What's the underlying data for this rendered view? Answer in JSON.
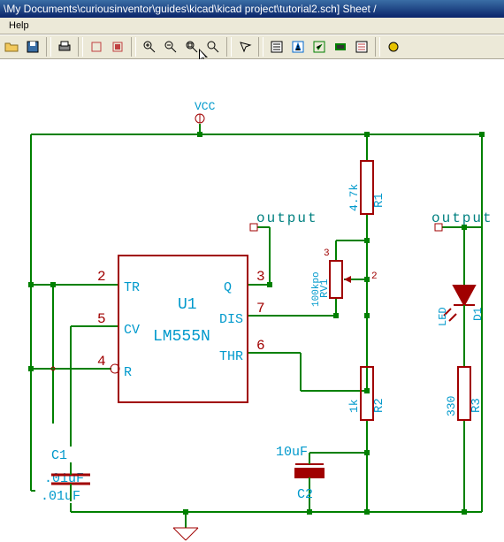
{
  "window": {
    "title": "\\My Documents\\curiousinventor\\guides\\kicad\\kicad project\\tutorial2.sch]  Sheet /"
  },
  "menu": {
    "help": "Help"
  },
  "toolbar": {
    "buttons": [
      "open",
      "save",
      "sep",
      "print",
      "sep",
      "cut",
      "copy",
      "sep",
      "zoom-in",
      "zoom-out",
      "zoom-fit",
      "zoom-redraw",
      "sep",
      "find",
      "sep",
      "netlist",
      "annotate",
      "erc",
      "cvpcb",
      "bom",
      "sep",
      "run"
    ]
  },
  "schematic": {
    "net_vcc": "VCC",
    "label_output1": "output",
    "label_output2": "output",
    "ic": {
      "ref": "U1",
      "value": "LM555N",
      "pins": {
        "p2_num": "2",
        "p2_name": "TR",
        "p5_num": "5",
        "p5_name": "CV",
        "p4_num": "4",
        "p4_name": "R",
        "p3_num": "3",
        "p3_name": "Q",
        "p7_num": "7",
        "p7_name": "DIS",
        "p6_num": "6",
        "p6_name": "THR"
      }
    },
    "c1": {
      "ref": "C1",
      "value": ".01uF"
    },
    "c2": {
      "ref": "C2",
      "value": "10uF"
    },
    "r1": {
      "ref": "R1",
      "value": "4.7k"
    },
    "r2": {
      "ref": "R2",
      "value": "1k"
    },
    "r3": {
      "ref": "R3",
      "value": "330"
    },
    "rv1": {
      "ref": "RV1",
      "value": "100kpo",
      "pin3": "3",
      "pin2": "2"
    },
    "d1": {
      "ref": "D1",
      "value": "LED"
    }
  }
}
